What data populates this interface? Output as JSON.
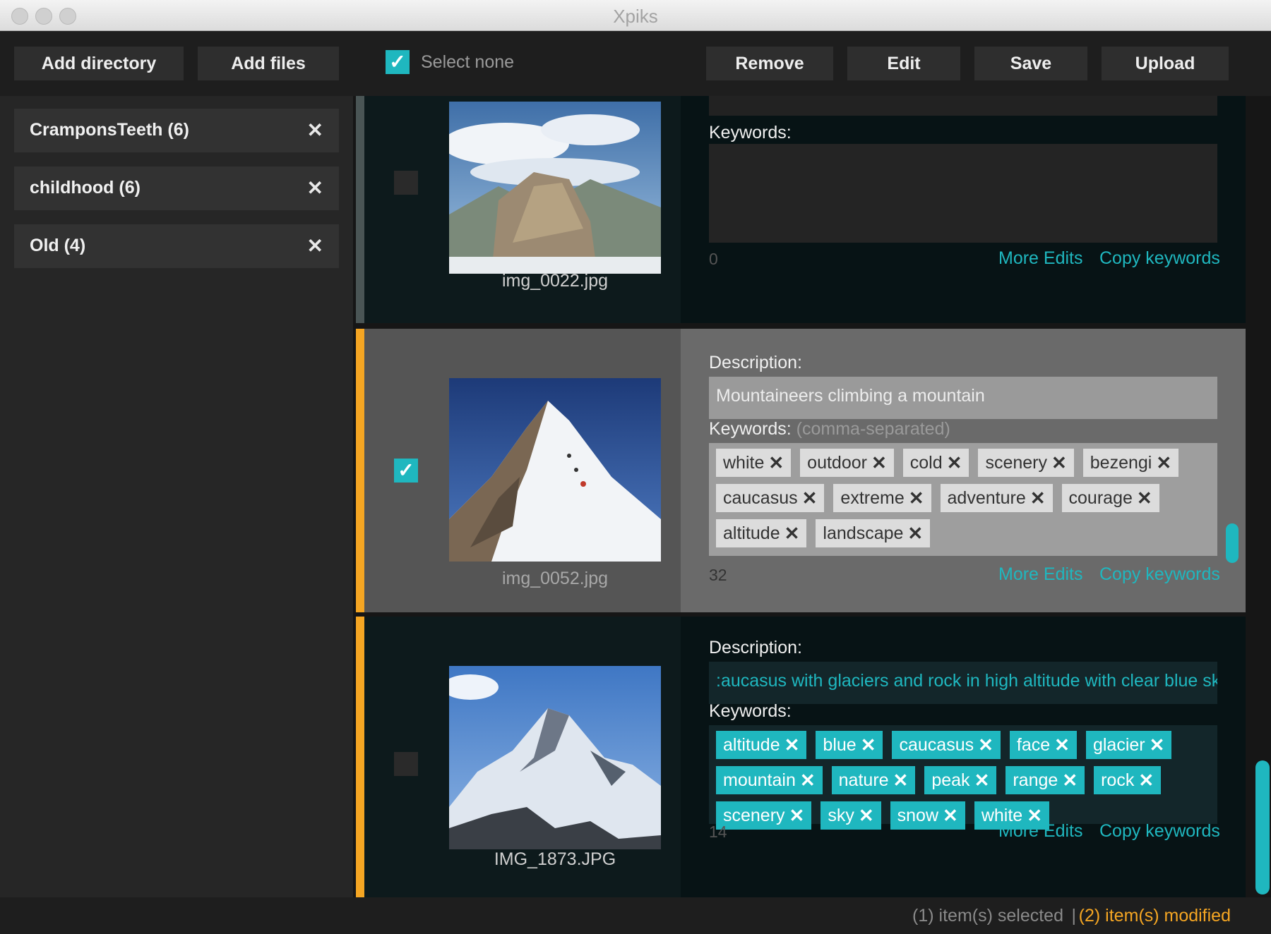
{
  "window": {
    "title": "Xpiks"
  },
  "toolbar": {
    "add_directory": "Add directory",
    "add_files": "Add files",
    "select_none": "Select none",
    "remove": "Remove",
    "edit": "Edit",
    "save": "Save",
    "upload": "Upload",
    "select_none_checked": true
  },
  "sidebar": {
    "directories": [
      {
        "label": "CramponsTeeth (6)"
      },
      {
        "label": "childhood (6)"
      },
      {
        "label": "Old (4)"
      }
    ]
  },
  "items": [
    {
      "filename": "img_0022.jpg",
      "selected": false,
      "modified": false,
      "keywords_label": "Keywords:",
      "keywords": [],
      "keyword_count": "0",
      "more_edits": "More Edits",
      "copy_keywords": "Copy keywords"
    },
    {
      "filename": "img_0052.jpg",
      "selected": true,
      "modified": true,
      "description_label": "Description:",
      "description": "Mountaineers climbing a mountain",
      "keywords_label": "Keywords:",
      "keywords_hint": "(comma-separated)",
      "keywords": [
        "white",
        "outdoor",
        "cold",
        "scenery",
        "bezengi",
        "caucasus",
        "extreme",
        "adventure",
        "courage",
        "altitude",
        "landscape"
      ],
      "keyword_count": "32",
      "more_edits": "More Edits",
      "copy_keywords": "Copy keywords"
    },
    {
      "filename": "IMG_1873.JPG",
      "selected": false,
      "modified": true,
      "description_label": "Description:",
      "description": ":aucasus with glaciers and rock in high altitude with clear blue sky",
      "keywords_label": "Keywords:",
      "keywords": [
        "altitude",
        "blue",
        "caucasus",
        "face",
        "glacier",
        "mountain",
        "nature",
        "peak",
        "range",
        "rock",
        "scenery",
        "sky",
        "snow",
        "white"
      ],
      "keyword_count": "14",
      "more_edits": "More Edits",
      "copy_keywords": "Copy keywords"
    }
  ],
  "status": {
    "selected": "(1) item(s) selected",
    "separator": "|",
    "modified": "(2) item(s) modified"
  },
  "colors": {
    "accent": "#1fb7bf",
    "modified": "#f5a623",
    "background": "#242424"
  },
  "icons": {
    "remove_directory": "close-icon",
    "remove_keyword": "close-icon",
    "checkbox": "checkmark-icon"
  }
}
